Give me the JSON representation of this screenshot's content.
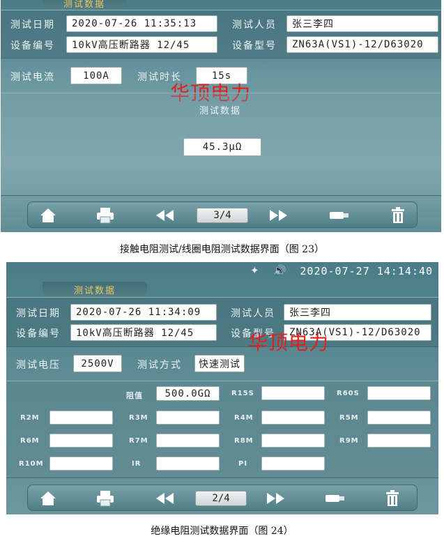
{
  "screen1": {
    "tab_label": "测试数据",
    "fields": {
      "test_date_label": "测试日期",
      "test_date_value": "2020-07-26 11:35:13",
      "tester_label": "测试人员",
      "tester_value": "张三李四",
      "device_no_label": "设备编号",
      "device_no_value": "10kV高压断路器 12/45",
      "device_model_label": "设备型号",
      "device_model_value": "ZN63A(VS1)-12/D63020"
    },
    "current_label": "测试电流",
    "current_value": "100A",
    "duration_label": "测试时长",
    "duration_value": "15s",
    "watermark": "华顶电力",
    "data_title": "测试数据",
    "result_value": "45.3μΩ",
    "pager": "3/4"
  },
  "caption1": "接触电阻测试/线圈电阻测试数据界面（图 23）",
  "screen2": {
    "clock": "2020-07-27 14:14:40",
    "tab_label": "测试数据",
    "fields": {
      "test_date_label": "测试日期",
      "test_date_value": "2020-07-26 11:34:09",
      "tester_label": "测试人员",
      "tester_value": "张三李四",
      "device_no_label": "设备编号",
      "device_no_value": "10kV高压断路器 12/45",
      "device_model_label": "设备型号",
      "device_model_value": "ZN63A(VS1)-12/D63020"
    },
    "voltage_label": "测试电压",
    "voltage_value": "2500V",
    "method_label": "测试方式",
    "method_value": "快速测试",
    "resistance_label": "阻值",
    "resistance_value": "500.0GΩ",
    "cells": {
      "r15s": "R15S",
      "r60s": "R60S",
      "r2m": "R2M",
      "r3m": "R3M",
      "r4m": "R4M",
      "r5m": "R5M",
      "r6m": "R6M",
      "r7m": "R7M",
      "r8m": "R8M",
      "r9m": "R9M",
      "r10m": "R10M",
      "ir": "IR",
      "pi": "PI"
    },
    "watermark": "华顶电力",
    "pager": "2/4"
  },
  "caption2": "绝缘电阻测试数据界面（图 24）",
  "icons": [
    "home-icon",
    "print-icon",
    "previous-icon",
    "next-icon",
    "usb-icon",
    "trash-icon",
    "bluetooth-icon",
    "speaker-icon"
  ],
  "colors": {
    "screen_bg": "#5f8c95",
    "tab_text": "#e9c75a",
    "watermark": "#e2201c"
  }
}
